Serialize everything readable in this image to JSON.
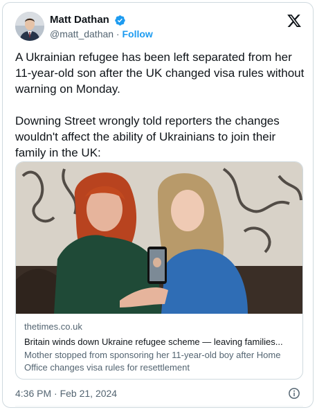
{
  "author": {
    "display_name": "Matt Dathan",
    "handle": "@matt_dathan",
    "separator": " · ",
    "follow_label": "Follow",
    "verified_color": "#1d9bf0"
  },
  "tweet": {
    "text": "A Ukrainian refugee has been left separated from her 11-year-old son after the UK changed visa rules without warning on Monday.\n\nDowning Street wrongly told reporters the changes wouldn't affect the ability of Ukrainians to join their family in the UK:",
    "timestamp": "4:36 PM · Feb 21, 2024"
  },
  "link_card": {
    "domain": "thetimes.co.uk",
    "title": "Britain winds down Ukraine refugee scheme — leaving families...",
    "description": "Mother stopped from sponsoring her 11-year-old boy after Home Office changes visa rules for resettlement"
  },
  "icons": {
    "brand": "x-logo-icon",
    "verified": "verified-badge-icon",
    "info": "info-icon"
  },
  "colors": {
    "accent": "#1d9bf0",
    "secondary_text": "#536471",
    "border": "#cfd9de"
  }
}
